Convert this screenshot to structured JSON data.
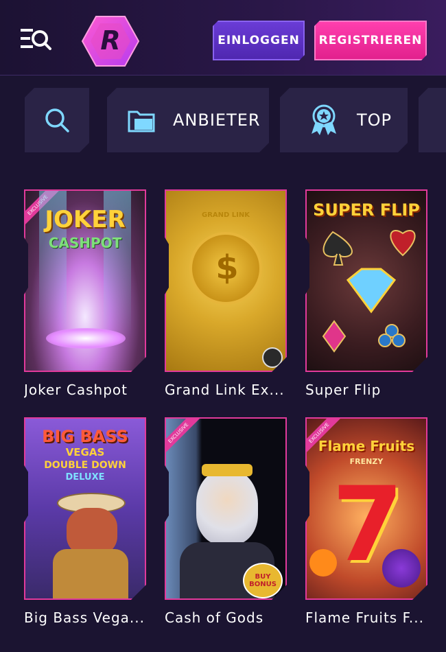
{
  "header": {
    "login_label": "EINLOGGEN",
    "register_label": "REGISTRIEREN",
    "logo_letter": "R",
    "menu_icon": "menu-search-icon"
  },
  "filters": {
    "search_icon": "search-icon",
    "provider_label": "ANBIETER",
    "provider_icon": "folder-icon",
    "top_label": "TOP",
    "top_icon": "award-ribbon-icon"
  },
  "games": [
    {
      "name": "Joker Cashpot",
      "art_title": "JOKER",
      "art_subtitle": "CASHPOT",
      "exclusive": true
    },
    {
      "name": "Grand Link Ex...",
      "art_title": "GRAND LINK",
      "art_subtitle": "",
      "exclusive": false
    },
    {
      "name": "Super Flip",
      "art_title": "SUPER FLIP",
      "art_subtitle": "",
      "exclusive": false
    },
    {
      "name": "Big Bass Vega...",
      "art_title": "BIG BASS",
      "art_subtitle": "VEGAS",
      "art_line3": "DOUBLE DOWN",
      "art_line4": "DELUXE",
      "exclusive": false
    },
    {
      "name": "Cash of Gods",
      "art_title": "",
      "art_subtitle": "",
      "badge": "BUY BONUS",
      "exclusive": true
    },
    {
      "name": "Flame Fruits F...",
      "art_title": "Flame Fruits",
      "art_subtitle": "FRENZY",
      "exclusive": true
    }
  ],
  "colors": {
    "background": "#1b1431",
    "accent_pink": "#e23a9b",
    "accent_purple": "#6a3cd6",
    "filter_bg": "#2a2346"
  }
}
